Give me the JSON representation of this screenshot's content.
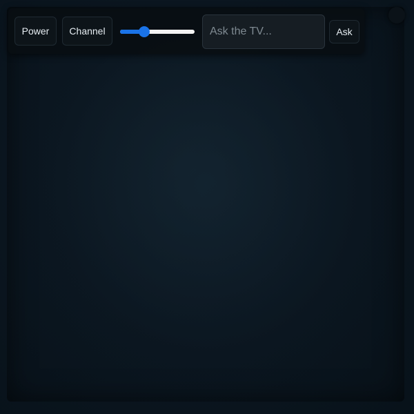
{
  "controls": {
    "power_label": "Power",
    "channel_label": "Channel",
    "volume_level": 0.32,
    "ask_placeholder": "Ask the TV...",
    "ask_value": "",
    "ask_label": "Ask"
  },
  "colors": {
    "accent": "#1a73e8",
    "background": "#0b1620"
  }
}
